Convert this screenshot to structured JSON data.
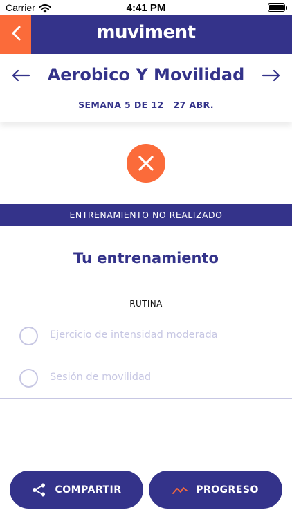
{
  "status_bar": {
    "carrier": "Carrier",
    "time": "4:41 PM"
  },
  "app": {
    "logo_text": "muviment",
    "back_icon": "chevron-left-icon"
  },
  "workout": {
    "title": "Aerobico Y Movilidad",
    "week": "SEMANA 5 DE 12",
    "date": "27 ABR.",
    "prev_icon": "arrow-left-icon",
    "next_icon": "arrow-right-icon"
  },
  "status": {
    "banner": "ENTRENAMIENTO NO REALIZADO",
    "icon": "close-icon"
  },
  "main": {
    "title": "Tu entrenamiento",
    "routine_label": "RUTINA",
    "exercises": [
      {
        "label": "Ejercicio de intensidad moderada",
        "checked": false
      },
      {
        "label": "Sesión de movilidad",
        "checked": false
      }
    ]
  },
  "actions": {
    "share_label": "COMPARTIR",
    "share_icon": "share-icon",
    "progress_label": "PROGRESO",
    "progress_icon": "trend-line-icon"
  },
  "colors": {
    "primary": "#34338a",
    "accent": "#fb6b3a",
    "muted": "#c7c7e3"
  }
}
